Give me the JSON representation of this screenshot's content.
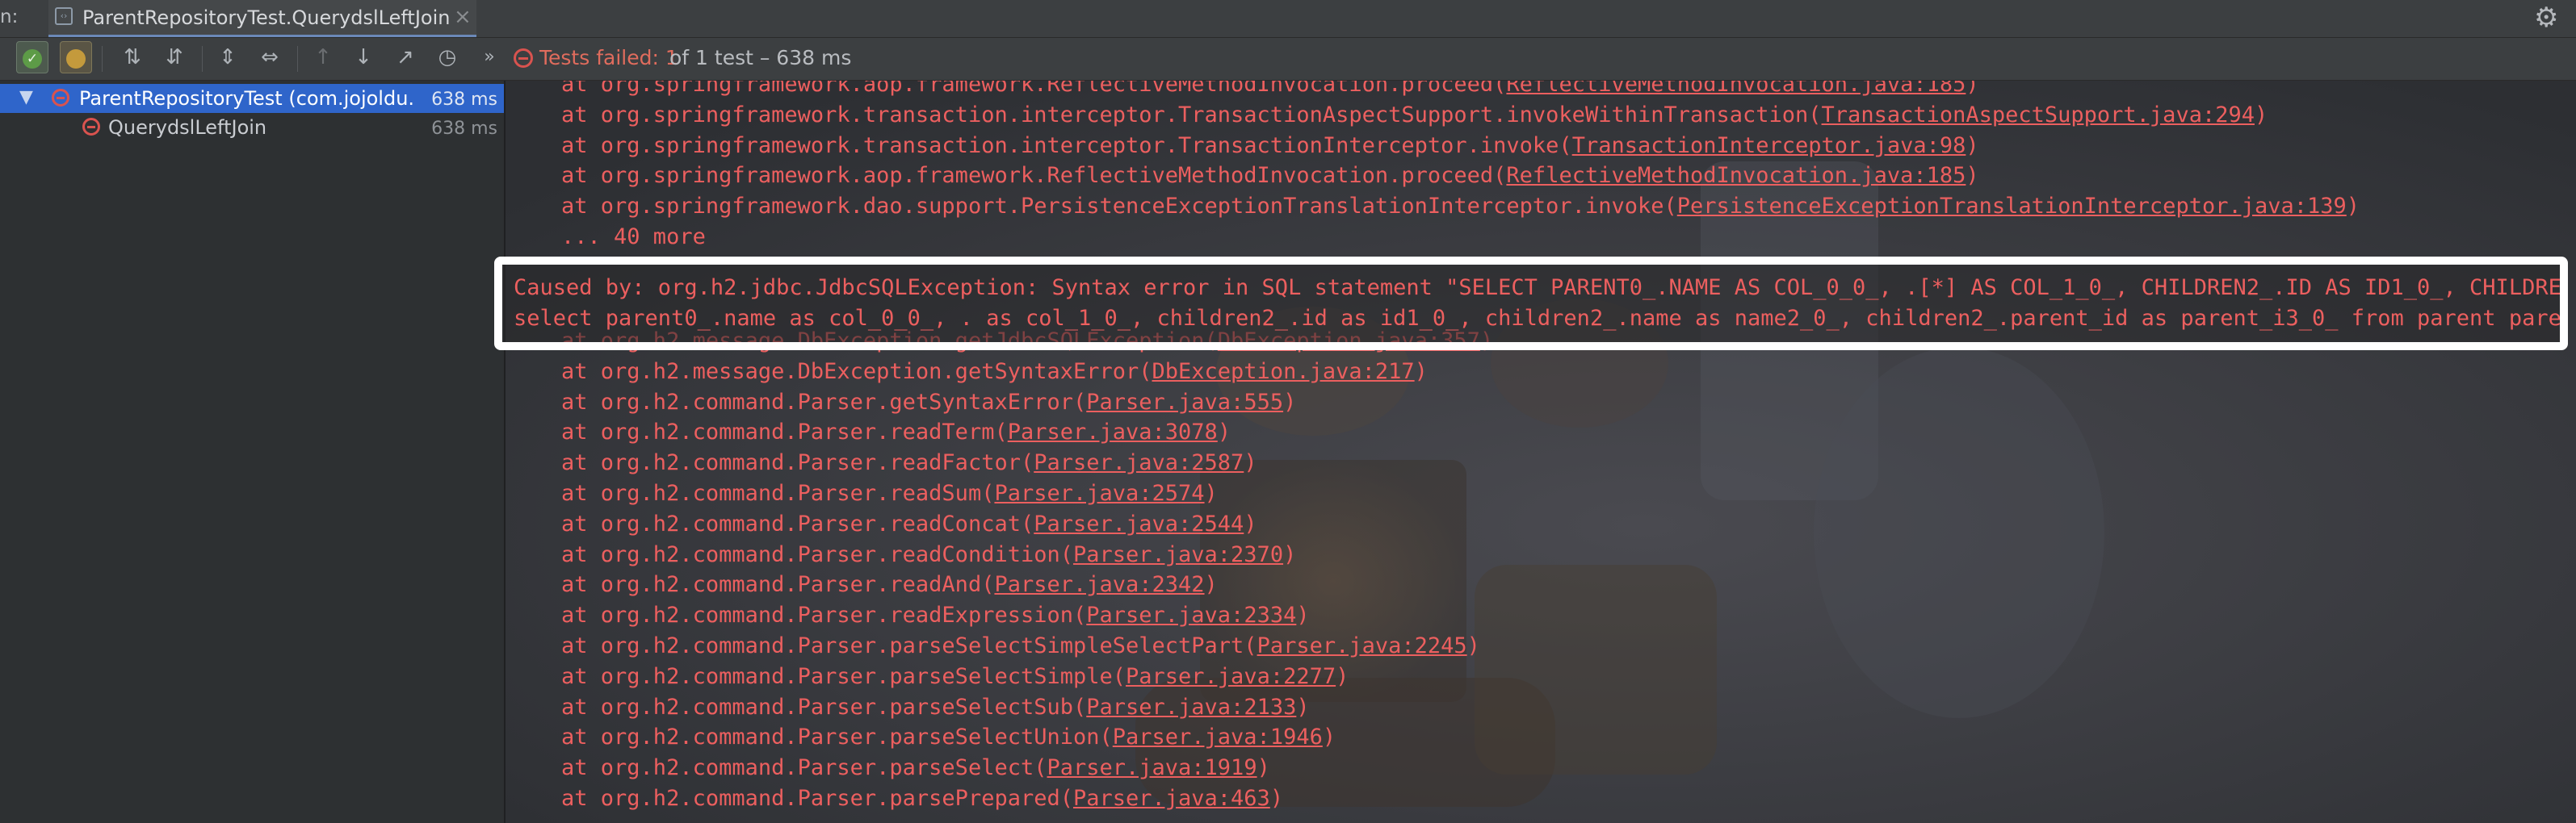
{
  "tabbar": {
    "prefix": "n:",
    "tab_title": "ParentRepositoryTest.QuerydslLeftJoin",
    "close_glyph": "×",
    "settings_icon": "gear-icon"
  },
  "toolbar": {
    "status_failed": "Tests failed: 1",
    "status_count": "of 1 test – 638 ms",
    "more_glyph": "»"
  },
  "tree": {
    "root": {
      "label": "ParentRepositoryTest (com.jojoldu.",
      "time": "638 ms"
    },
    "child": {
      "label": "QuerydslLeftJoin",
      "time": "638 ms"
    }
  },
  "console": {
    "lines_top": [
      {
        "pre": "    at org.springframework.aop.framework.ReflectiveMethodInvocation.proceed(",
        "link": "ReflectiveMethodInvocation.java:185",
        "post": ")"
      },
      {
        "pre": "    at org.springframework.transaction.interceptor.TransactionAspectSupport.invokeWithinTransaction(",
        "link": "TransactionAspectSupport.java:294",
        "post": ")"
      },
      {
        "pre": "    at org.springframework.transaction.interceptor.TransactionInterceptor.invoke(",
        "link": "TransactionInterceptor.java:98",
        "post": ")"
      },
      {
        "pre": "    at org.springframework.aop.framework.ReflectiveMethodInvocation.proceed(",
        "link": "ReflectiveMethodInvocation.java:185",
        "post": ")"
      },
      {
        "pre": "    at org.springframework.dao.support.PersistenceExceptionTranslationInterceptor.invoke(",
        "link": "PersistenceExceptionTranslationInterceptor.java:139",
        "post": ")"
      },
      {
        "pre": "    ... 40 more",
        "link": "",
        "post": ""
      }
    ],
    "caused_by": [
      "Caused by: org.h2.jdbc.JdbcSQLException: Syntax error in SQL statement \"SELECT PARENT0_.NAME AS COL_0_0_, .[*] AS COL_1_0_, CHILDREN2_.ID AS ID1_0_, CHILDREN",
      "select parent0_.name as col_0_0_, . as col_1_0_, children2_.id as id1_0_, children2_.name as name2_0_, children2_.parent_id as parent_i3_0_ from parent paren"
    ],
    "lines_bottom": [
      {
        "pre": "    at org.h2.message.DbException.getJdbcSQLException(",
        "link": "DbException.java:357",
        "post": ")"
      },
      {
        "pre": "    at org.h2.message.DbException.getSyntaxError(",
        "link": "DbException.java:217",
        "post": ")"
      },
      {
        "pre": "    at org.h2.command.Parser.getSyntaxError(",
        "link": "Parser.java:555",
        "post": ")"
      },
      {
        "pre": "    at org.h2.command.Parser.readTerm(",
        "link": "Parser.java:3078",
        "post": ")"
      },
      {
        "pre": "    at org.h2.command.Parser.readFactor(",
        "link": "Parser.java:2587",
        "post": ")"
      },
      {
        "pre": "    at org.h2.command.Parser.readSum(",
        "link": "Parser.java:2574",
        "post": ")"
      },
      {
        "pre": "    at org.h2.command.Parser.readConcat(",
        "link": "Parser.java:2544",
        "post": ")"
      },
      {
        "pre": "    at org.h2.command.Parser.readCondition(",
        "link": "Parser.java:2370",
        "post": ")"
      },
      {
        "pre": "    at org.h2.command.Parser.readAnd(",
        "link": "Parser.java:2342",
        "post": ")"
      },
      {
        "pre": "    at org.h2.command.Parser.readExpression(",
        "link": "Parser.java:2334",
        "post": ")"
      },
      {
        "pre": "    at org.h2.command.Parser.parseSelectSimpleSelectPart(",
        "link": "Parser.java:2245",
        "post": ")"
      },
      {
        "pre": "    at org.h2.command.Parser.parseSelectSimple(",
        "link": "Parser.java:2277",
        "post": ")"
      },
      {
        "pre": "    at org.h2.command.Parser.parseSelectSub(",
        "link": "Parser.java:2133",
        "post": ")"
      },
      {
        "pre": "    at org.h2.command.Parser.parseSelectUnion(",
        "link": "Parser.java:1946",
        "post": ")"
      },
      {
        "pre": "    at org.h2.command.Parser.parseSelect(",
        "link": "Parser.java:1919",
        "post": ")"
      },
      {
        "pre": "    at org.h2.command.Parser.parsePrepared(",
        "link": "Parser.java:463",
        "post": ")"
      }
    ]
  },
  "colors": {
    "error_text": "#ec5f5f",
    "selection": "#2f65ca",
    "highlight_box": "#ffffff"
  }
}
